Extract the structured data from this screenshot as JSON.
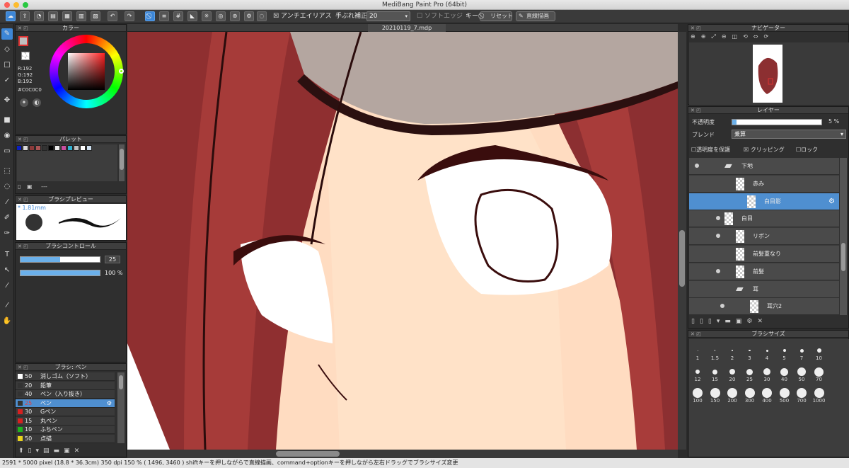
{
  "window": {
    "title": "MediBang Paint Pro (64bit)"
  },
  "toolbar": {
    "antialias_label": "アンチエイリアス",
    "stabilizer_label": "手ぶれ補正",
    "stabilizer_value": "20",
    "soft_edge_label": "ソフトエッジ",
    "key_label": "キー",
    "reset_label": "リセット",
    "straight_label": "直線描画"
  },
  "document": {
    "tab": "20210119_7.mdp"
  },
  "color_panel": {
    "title": "カラー",
    "r": "R:192",
    "g": "G:192",
    "b": "B:192",
    "hex": "#C0C0C0",
    "primary": "#c0c0c0"
  },
  "palette_panel": {
    "title": "パレット",
    "footer_text": "---",
    "swatches": [
      "#0a1fbf",
      "#d9d9d9",
      "#8c3a3a",
      "#a55",
      "#333",
      "#000",
      "#f0f0f0",
      "#c94ea0",
      "#30b0d0",
      "#c0c0c0",
      "#fff",
      "#cfe0f0"
    ]
  },
  "brush_preview": {
    "title": "ブラシプレビュー",
    "size": "* 1.81mm"
  },
  "brush_control": {
    "title": "ブラシコントロール",
    "size_value": "25",
    "opacity_value": "100 %",
    "size_fraction": 0.5,
    "opacity_fraction": 1.0
  },
  "brush_list": {
    "title": "ブラシ: ペン",
    "items": [
      {
        "num": "50",
        "name": "消しゴム（ソフト）",
        "color": "#ffffff"
      },
      {
        "num": "20",
        "name": "鉛筆",
        "color": "#333333"
      },
      {
        "num": "40",
        "name": "ペン（入り抜き）",
        "color": "#333333"
      },
      {
        "num": "25",
        "name": "ペン",
        "color": "#333333"
      },
      {
        "num": "30",
        "name": "Gペン",
        "color": "#d62020"
      },
      {
        "num": "15",
        "name": "丸ペン",
        "color": "#d62020"
      },
      {
        "num": "10",
        "name": "ふちペン",
        "color": "#1db31d"
      },
      {
        "num": "50",
        "name": "点描",
        "color": "#e8d21d"
      }
    ]
  },
  "navigator": {
    "title": "ナビゲーター"
  },
  "layer_panel": {
    "title": "レイヤー",
    "opacity_label": "不透明度",
    "opacity_value": "5 %",
    "opacity_fraction": 0.05,
    "blend_label": "ブレンド",
    "blend_value": "乗算",
    "protect_label": "透明度を保護",
    "clipping_label": "クリッピング",
    "lock_label": "ロック",
    "layers": [
      {
        "name": "下地"
      },
      {
        "name": "赤み"
      },
      {
        "name": "白目影"
      },
      {
        "name": "白目"
      },
      {
        "name": "リボン"
      },
      {
        "name": "前髪重なり"
      },
      {
        "name": "前髪"
      },
      {
        "name": "耳"
      },
      {
        "name": "耳穴2"
      }
    ]
  },
  "brush_size_panel": {
    "title": "ブラシサイズ",
    "sizes": [
      "1",
      "1.5",
      "2",
      "3",
      "4",
      "5",
      "7",
      "10",
      "12",
      "15",
      "20",
      "25",
      "30",
      "40",
      "50",
      "70",
      "100",
      "150",
      "200",
      "300",
      "400",
      "500",
      "700",
      "1000"
    ]
  },
  "status": {
    "text": "2591 * 5000 pixel   (18.8 * 36.3cm)   350 dpi     150 %   ( 1496, 3460 )   shiftキーを押しながらで直線描画、command+optionキーを押しながら左右ドラッグでブラシサイズ変更"
  }
}
